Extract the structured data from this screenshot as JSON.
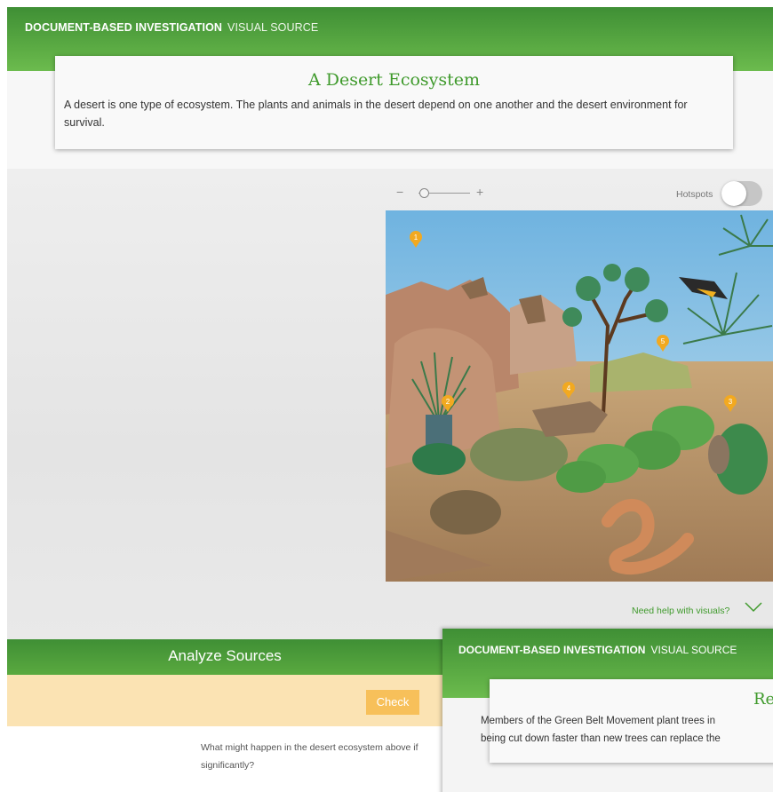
{
  "header": {
    "title_bold": "DOCUMENT-BASED INVESTIGATION",
    "title_sub": "VISUAL SOURCE"
  },
  "intro": {
    "title": "A Desert Ecosystem",
    "text": "A desert is one type of ecosystem. The plants and animals in the desert depend on one another and the desert environment for survival."
  },
  "viewer": {
    "zoom_minus": "−",
    "zoom_plus": "+",
    "zoom_level": 0.1,
    "hotspots_label": "Hotspots",
    "hotspots_on": false,
    "hotspot_markers": [
      "1",
      "2",
      "3",
      "4",
      "5"
    ],
    "help_label": "Need help with visuals?"
  },
  "analyze": {
    "title": "Analyze Sources",
    "check_label": "Check",
    "question": "What might happen in the desert ecosystem above if significantly?"
  },
  "next_page": {
    "title_bold": "DOCUMENT-BASED INVESTIGATION",
    "title_sub": "VISUAL SOURCE",
    "heading": "Re",
    "text_line1": "Members of the Green Belt Movement plant trees in",
    "text_line2": "being cut down faster than new trees can replace the"
  },
  "colors": {
    "brand_green": "#4a9c3a",
    "heading_green": "#3f9a2c",
    "hotspot_marker": "#f2a920",
    "check_button": "#f7c05a",
    "answer_band": "#fbe3b3"
  }
}
